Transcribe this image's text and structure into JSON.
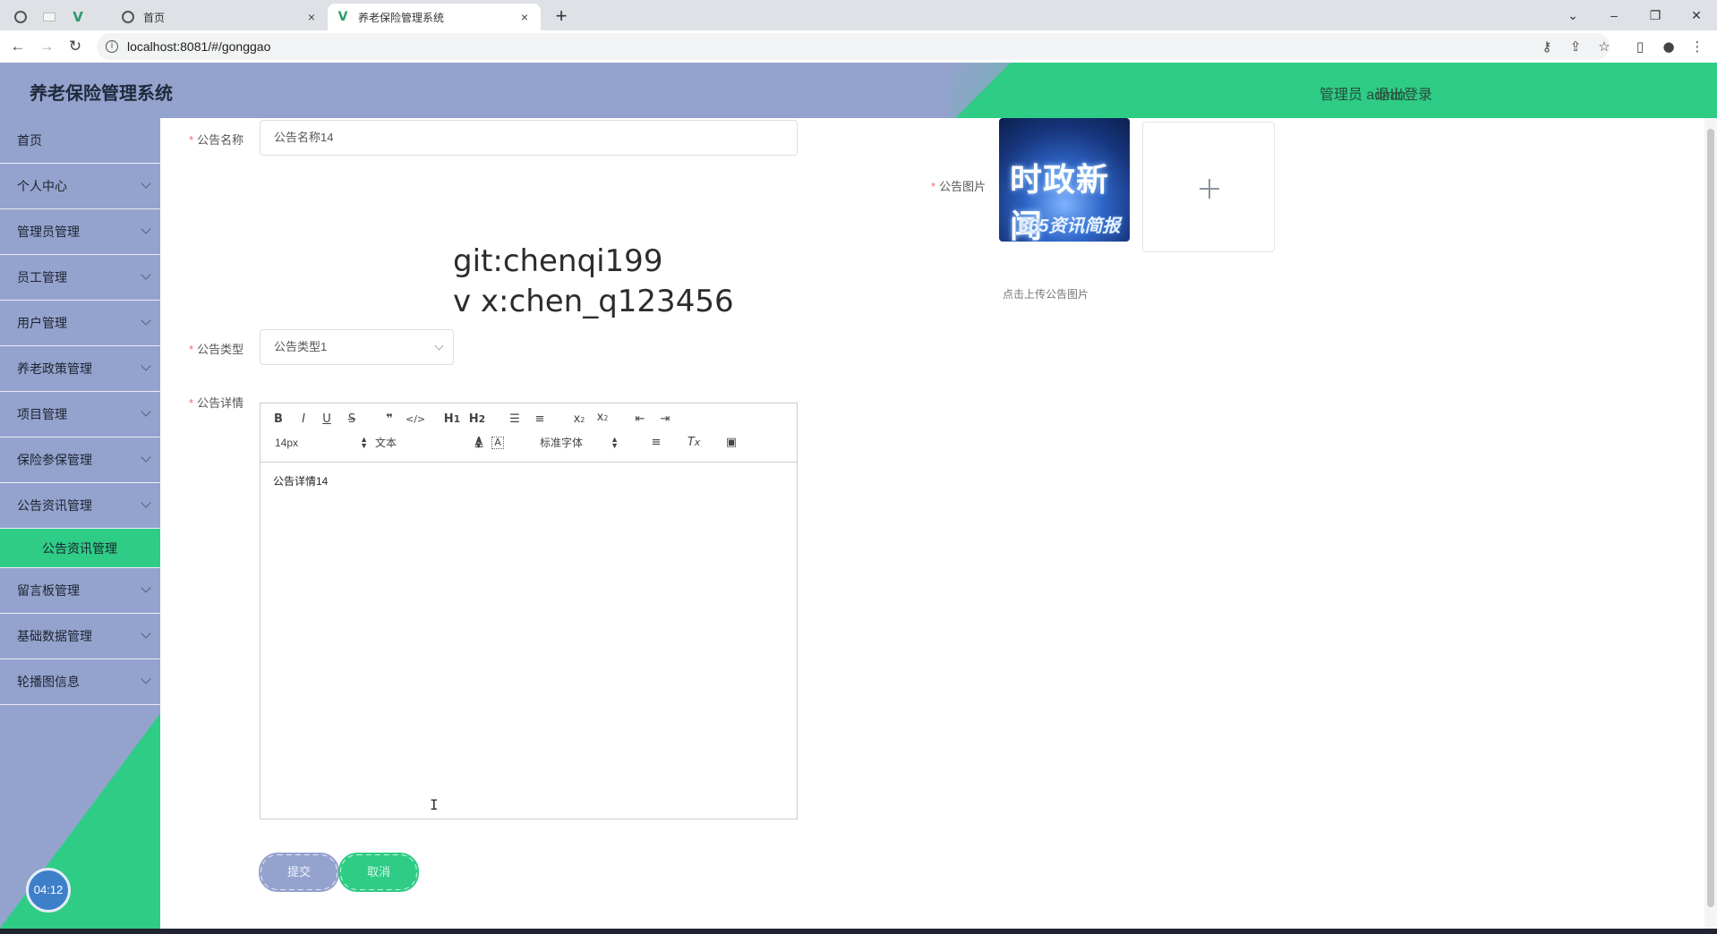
{
  "browser": {
    "tabs": [
      {
        "title": "首页",
        "close": "×"
      },
      {
        "title": "养老保险管理系统",
        "close": "×"
      }
    ],
    "new_tab": "+",
    "url": "localhost:8081/#/gonggao",
    "window_controls": {
      "down": "⌄",
      "minimize": "–",
      "restore": "❐",
      "close": "✕"
    },
    "nav": {
      "back": "←",
      "forward": "→",
      "reload": "↻"
    }
  },
  "header": {
    "title": "养老保险管理系统",
    "user": "管理员 admin",
    "logout": "退出登录"
  },
  "sidebar": {
    "items": [
      {
        "label": "首页"
      },
      {
        "label": "个人中心"
      },
      {
        "label": "管理员管理"
      },
      {
        "label": "员工管理"
      },
      {
        "label": "用户管理"
      },
      {
        "label": "养老政策管理"
      },
      {
        "label": "项目管理"
      },
      {
        "label": "保险参保管理"
      },
      {
        "label": "公告资讯管理"
      },
      {
        "label": "留言板管理"
      },
      {
        "label": "基础数据管理"
      },
      {
        "label": "轮播图信息"
      }
    ],
    "active_sub": "公告资讯管理",
    "clock": "04:12"
  },
  "form": {
    "name_label": "公告名称",
    "name_value": "公告名称14",
    "type_label": "公告类型",
    "type_value": "公告类型1",
    "detail_label": "公告详情",
    "image_label": "公告图片",
    "image_tip": "点击上传公告图片",
    "thumb_text_1": "时政新闻",
    "thumb_text_2": "365资讯简报",
    "watermark_1": "git:chenqi199",
    "watermark_2": "v x:chen_q123456",
    "editor": {
      "font_size": "14px",
      "block": "文本",
      "font_family": "标准字体",
      "content": "公告详情14"
    },
    "submit": "提交",
    "cancel": "取消"
  },
  "colors": {
    "header_blue": "#94a3cd",
    "accent_green": "#2ecc85",
    "required_red": "#f56c6c"
  }
}
